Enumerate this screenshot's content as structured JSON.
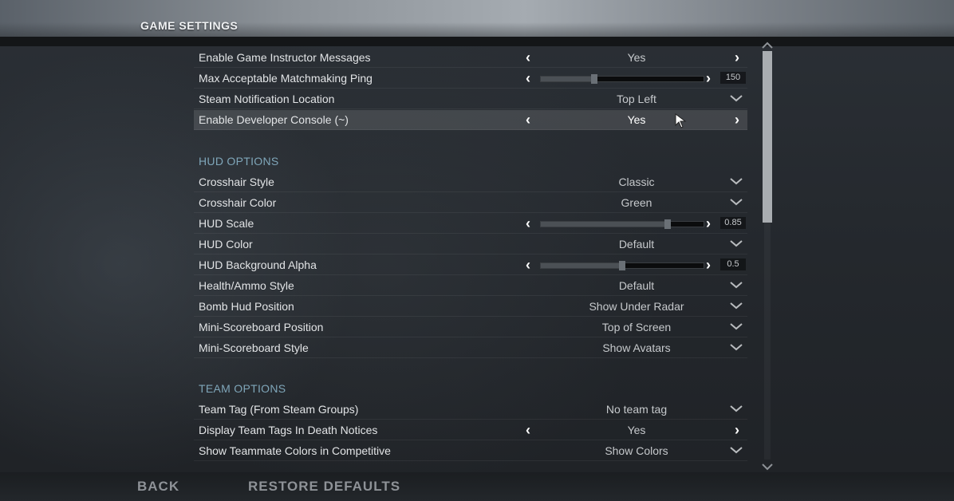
{
  "header": {
    "title": "GAME SETTINGS"
  },
  "rows": [
    {
      "label": "Enable Game Instructor Messages",
      "control": "arrows",
      "value": "Yes"
    },
    {
      "label": "Max Acceptable Matchmaking Ping",
      "control": "slider",
      "value": "150",
      "level": 0.33
    },
    {
      "label": "Steam Notification Location",
      "control": "dropdown",
      "value": "Top Left"
    },
    {
      "label": "Enable Developer Console (~)",
      "control": "arrows",
      "value": "Yes",
      "highlighted": true
    }
  ],
  "hud": {
    "header": "HUD OPTIONS",
    "rows": [
      {
        "label": "Crosshair Style",
        "control": "dropdown",
        "value": "Classic"
      },
      {
        "label": "Crosshair Color",
        "control": "dropdown",
        "value": "Green"
      },
      {
        "label": "HUD Scale",
        "control": "slider",
        "value": "0.85",
        "level": 0.78
      },
      {
        "label": "HUD Color",
        "control": "dropdown",
        "value": "Default"
      },
      {
        "label": "HUD Background Alpha",
        "control": "slider",
        "value": "0.5",
        "level": 0.5
      },
      {
        "label": "Health/Ammo Style",
        "control": "dropdown",
        "value": "Default"
      },
      {
        "label": "Bomb Hud Position",
        "control": "dropdown",
        "value": "Show Under Radar"
      },
      {
        "label": "Mini-Scoreboard Position",
        "control": "dropdown",
        "value": "Top of Screen"
      },
      {
        "label": "Mini-Scoreboard Style",
        "control": "dropdown",
        "value": "Show Avatars"
      }
    ]
  },
  "team": {
    "header": "TEAM OPTIONS",
    "rows": [
      {
        "label": "Team Tag (From Steam Groups)",
        "control": "dropdown",
        "value": "No team tag"
      },
      {
        "label": "Display Team Tags In Death Notices",
        "control": "arrows",
        "value": "Yes"
      },
      {
        "label": "Show Teammate Colors in Competitive",
        "control": "dropdown",
        "value": "Show Colors"
      }
    ]
  },
  "footer": {
    "back": "BACK",
    "restore": "RESTORE DEFAULTS"
  },
  "icons": {
    "arrow_left": "‹",
    "arrow_right": "›",
    "dropdown": "chevron-down-icon",
    "scroll_up": "chevron-up-icon",
    "scroll_down": "chevron-down-icon",
    "cursor": "mouse-pointer-icon"
  },
  "colors": {
    "section_header": "#7fa6b9",
    "highlight_row": "rgba(255,255,255,0.12)",
    "scroll_thumb": "#a9adb1"
  },
  "scrollbar": {
    "position": 0.0,
    "visible_fraction": 0.42
  }
}
